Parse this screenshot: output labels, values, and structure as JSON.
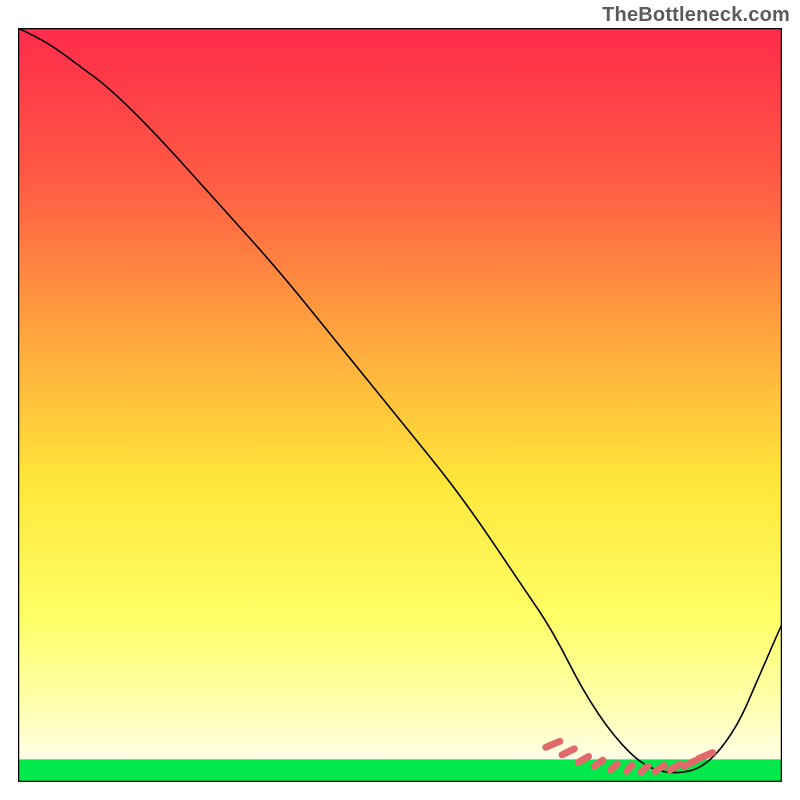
{
  "watermark": "TheBottleneck.com",
  "chart_data": {
    "type": "line",
    "title": "",
    "xlabel": "",
    "ylabel": "",
    "xlim": [
      0,
      100
    ],
    "ylim": [
      0,
      100
    ],
    "grid": false,
    "legend": false,
    "gradient": {
      "stops": [
        {
          "offset": 0.0,
          "color": "#ff2b4b"
        },
        {
          "offset": 0.2,
          "color": "#ff5a44"
        },
        {
          "offset": 0.4,
          "color": "#ffa33e"
        },
        {
          "offset": 0.6,
          "color": "#ffe63a"
        },
        {
          "offset": 0.78,
          "color": "#ffff66"
        },
        {
          "offset": 0.9,
          "color": "#ffffb0"
        },
        {
          "offset": 1.0,
          "color": "#ffffff"
        }
      ]
    },
    "green_band": {
      "ymin": 0,
      "ymax": 3
    },
    "series": [
      {
        "name": "curve",
        "type": "line",
        "color": "#000000",
        "x": [
          0,
          4,
          8,
          12,
          18,
          26,
          34,
          42,
          50,
          58,
          66,
          70,
          74,
          78,
          82,
          86,
          90,
          94,
          97,
          100
        ],
        "values": [
          100,
          98,
          95,
          92,
          86,
          77,
          68,
          58,
          48,
          38,
          26,
          20,
          12,
          6,
          2,
          1,
          2,
          7,
          14,
          21
        ]
      },
      {
        "name": "flat-marks",
        "type": "scatter",
        "color": "#e06a6a",
        "x": [
          70,
          72,
          74,
          76,
          78,
          80,
          82,
          84,
          86,
          88,
          90
        ],
        "values": [
          5,
          4,
          3,
          2.5,
          2,
          1.8,
          1.7,
          1.8,
          2,
          2.5,
          3.5
        ]
      }
    ],
    "annotations": []
  }
}
